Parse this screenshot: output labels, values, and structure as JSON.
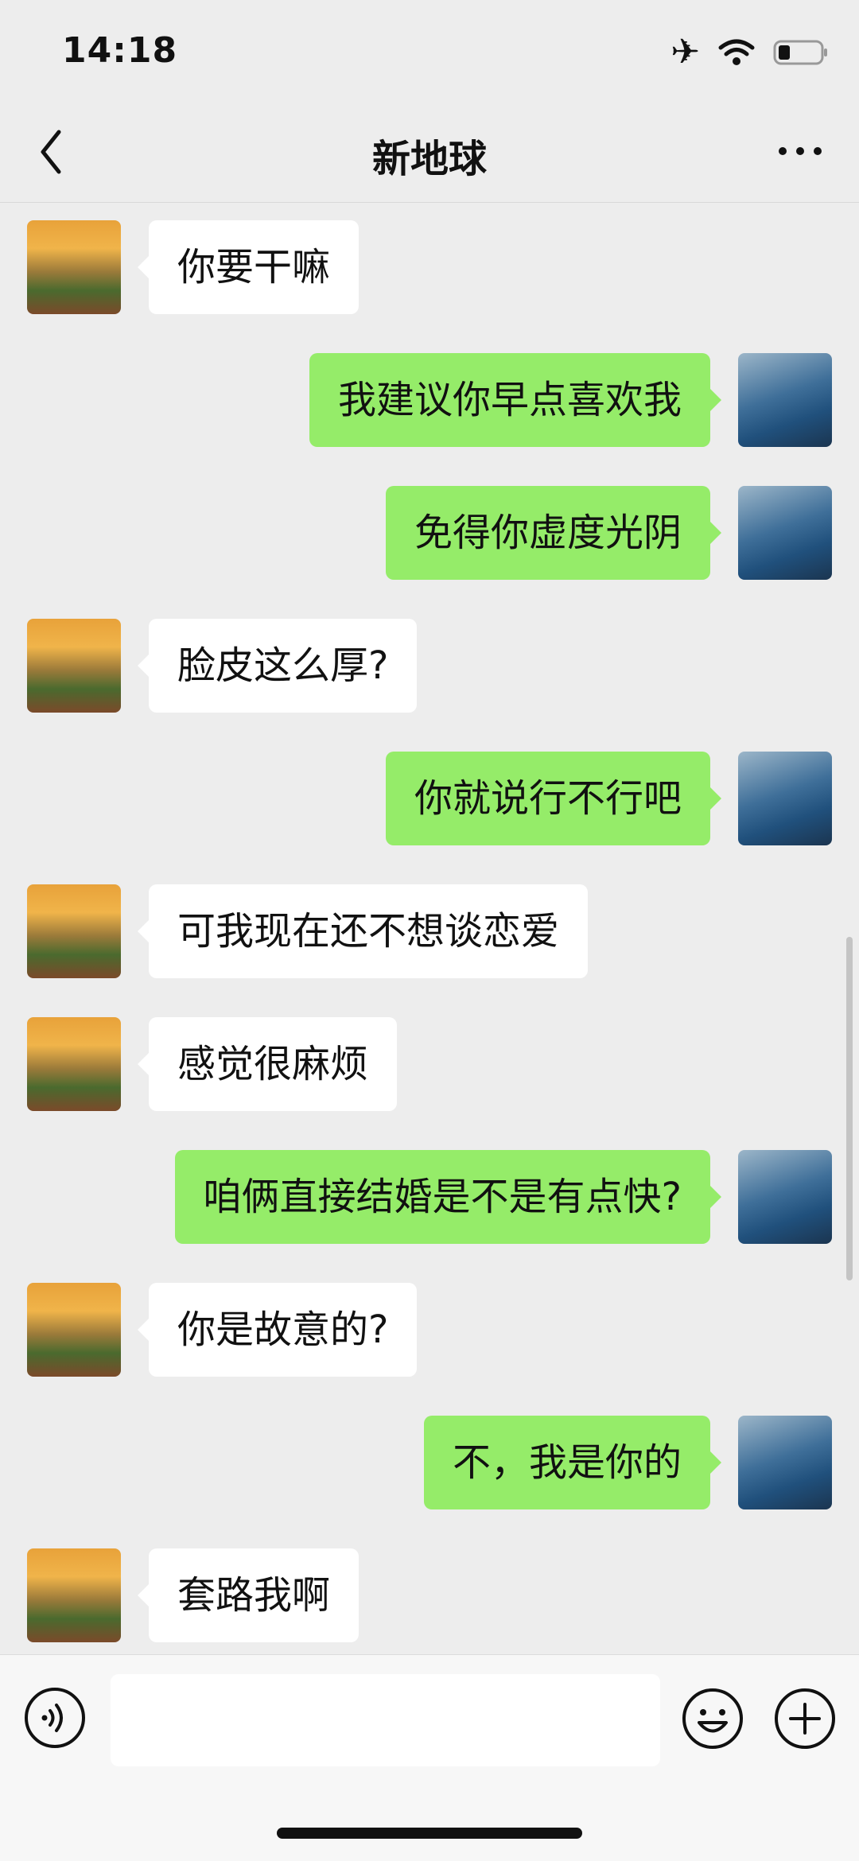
{
  "status_bar": {
    "time": "14:18"
  },
  "header": {
    "title": "新地球"
  },
  "messages": [
    {
      "side": "left",
      "text": "你要干嘛"
    },
    {
      "side": "right",
      "text": "我建议你早点喜欢我"
    },
    {
      "side": "right",
      "text": "免得你虚度光阴"
    },
    {
      "side": "left",
      "text": "脸皮这么厚?"
    },
    {
      "side": "right",
      "text": "你就说行不行吧"
    },
    {
      "side": "left",
      "text": "可我现在还不想谈恋爱"
    },
    {
      "side": "left",
      "text": "感觉很麻烦"
    },
    {
      "side": "right",
      "text": "咱俩直接结婚是不是有点快?"
    },
    {
      "side": "left",
      "text": "你是故意的?"
    },
    {
      "side": "right",
      "text": "不，我是你的"
    },
    {
      "side": "left",
      "text": "套路我啊"
    }
  ],
  "input": {
    "value": ""
  },
  "colors": {
    "self_bubble": "#95ec69",
    "other_bubble": "#ffffff",
    "background": "#ededed"
  },
  "icons": [
    "airplane-icon",
    "wifi-icon",
    "battery-icon",
    "back-icon",
    "more-icon",
    "voice-icon",
    "emoji-icon",
    "plus-icon"
  ]
}
